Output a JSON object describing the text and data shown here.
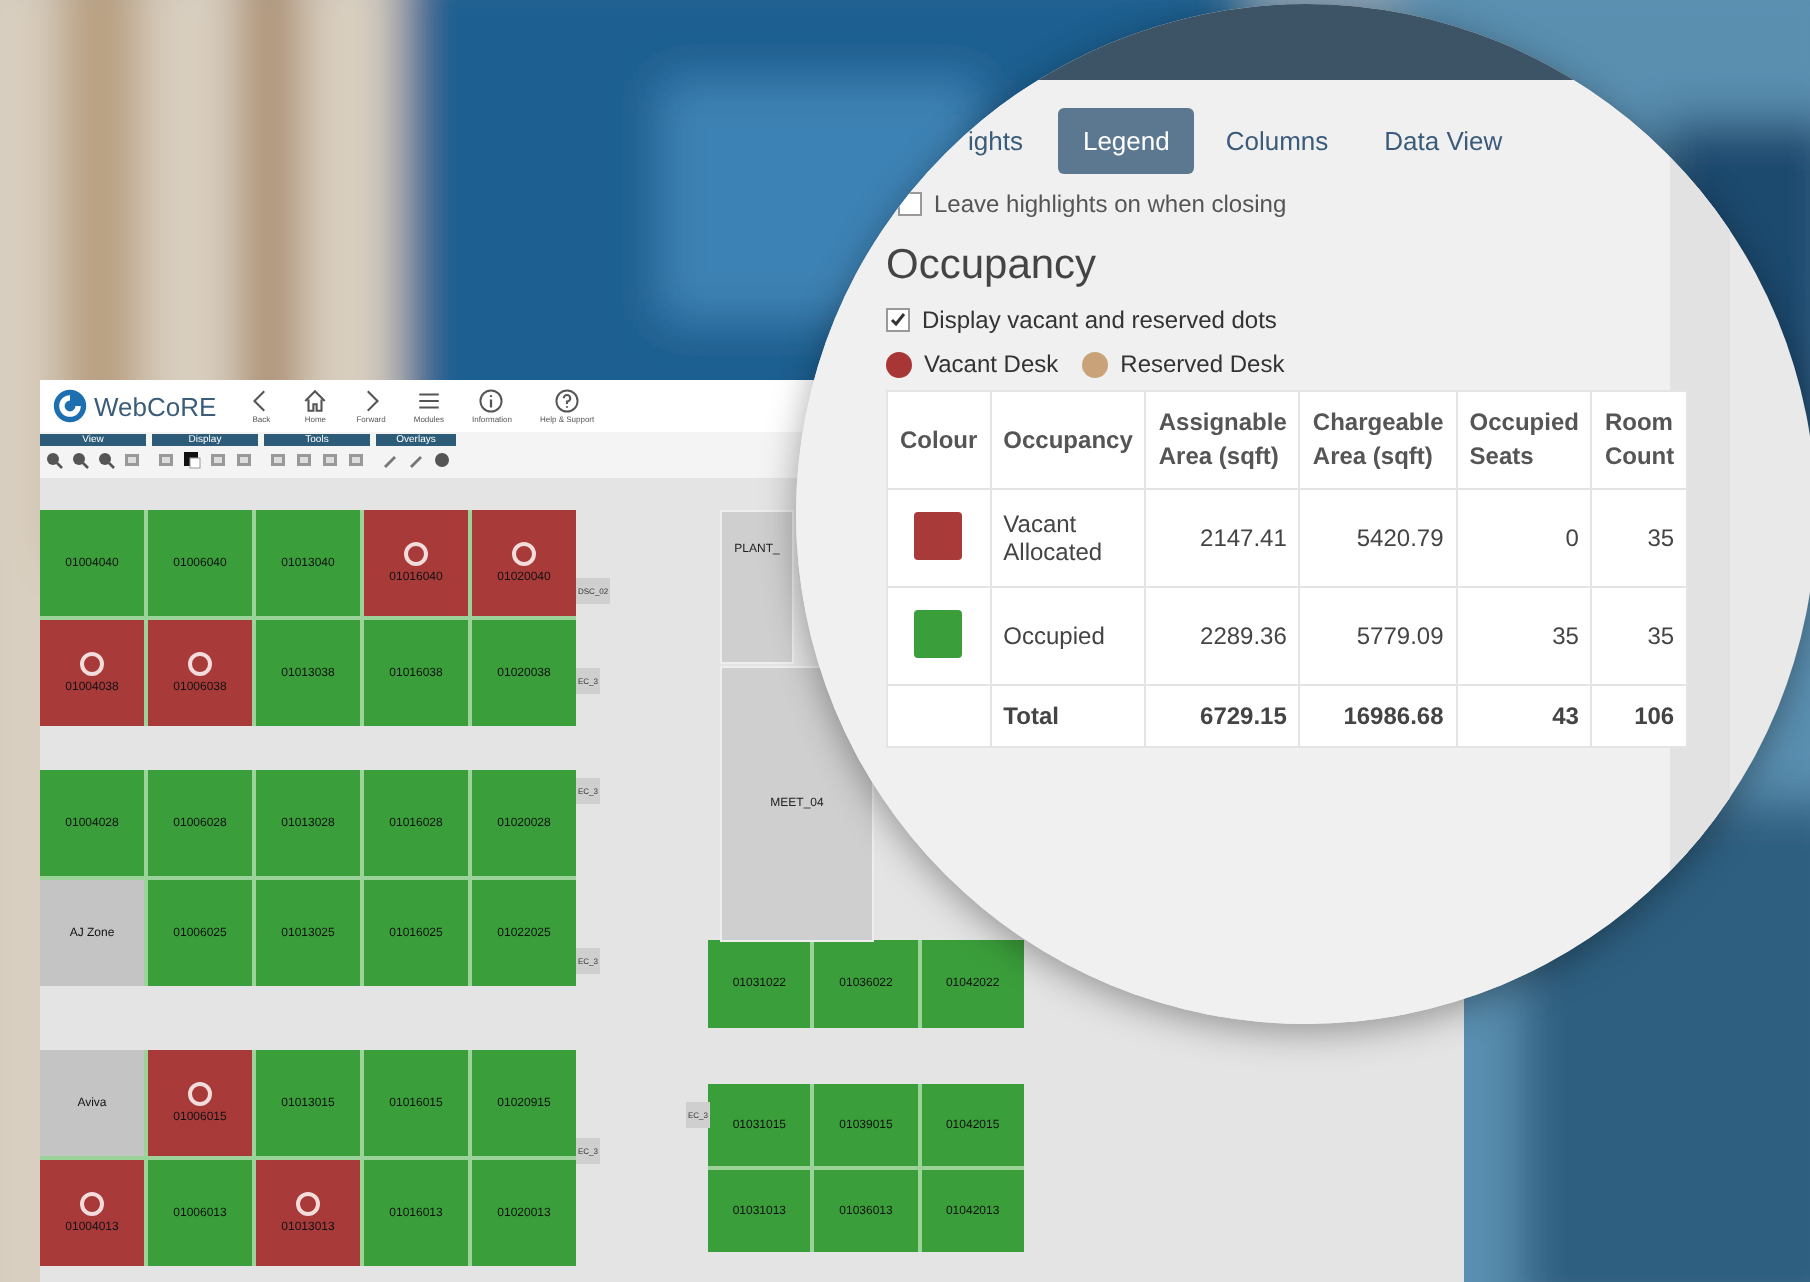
{
  "app": {
    "logo": "WebCoRE",
    "nav": [
      {
        "label": "Back"
      },
      {
        "label": "Home"
      },
      {
        "label": "Forward"
      },
      {
        "label": "Modules"
      },
      {
        "label": "Information"
      },
      {
        "label": "Help & Support"
      }
    ],
    "toolbar_groups": [
      {
        "title": "View"
      },
      {
        "title": "Display"
      },
      {
        "title": "Tools"
      },
      {
        "title": "Overlays"
      }
    ]
  },
  "floor_plan": {
    "left_blocks": [
      [
        [
          {
            "label": "01004040",
            "kind": "occupied",
            "dot": false
          },
          {
            "label": "01006040",
            "kind": "occupied",
            "dot": false
          },
          {
            "label": "01013040",
            "kind": "occupied",
            "dot": false
          },
          {
            "label": "01016040",
            "kind": "vacant",
            "dot": true
          },
          {
            "label": "01020040",
            "kind": "vacant",
            "dot": true
          }
        ],
        [
          {
            "label": "01004038",
            "kind": "vacant",
            "dot": true
          },
          {
            "label": "01006038",
            "kind": "vacant",
            "dot": true
          },
          {
            "label": "01013038",
            "kind": "occupied",
            "dot": false
          },
          {
            "label": "01016038",
            "kind": "occupied",
            "dot": false
          },
          {
            "label": "01020038",
            "kind": "occupied",
            "dot": false
          }
        ]
      ],
      [
        [
          {
            "label": "01004028",
            "kind": "occupied",
            "dot": false
          },
          {
            "label": "01006028",
            "kind": "occupied",
            "dot": false
          },
          {
            "label": "01013028",
            "kind": "occupied",
            "dot": false
          },
          {
            "label": "01016028",
            "kind": "occupied",
            "dot": false
          },
          {
            "label": "01020028",
            "kind": "occupied",
            "dot": false
          }
        ],
        [
          {
            "label": "AJ Zone",
            "kind": "zone",
            "dot": false
          },
          {
            "label": "01006025",
            "kind": "occupied",
            "dot": false
          },
          {
            "label": "01013025",
            "kind": "occupied",
            "dot": false
          },
          {
            "label": "01016025",
            "kind": "occupied",
            "dot": false
          },
          {
            "label": "01022025",
            "kind": "occupied",
            "dot": false
          }
        ]
      ],
      [
        [
          {
            "label": "Aviva",
            "kind": "zone",
            "dot": false
          },
          {
            "label": "01006015",
            "kind": "vacant",
            "dot": true
          },
          {
            "label": "01013015",
            "kind": "occupied",
            "dot": false
          },
          {
            "label": "01016015",
            "kind": "occupied",
            "dot": false
          },
          {
            "label": "01020915",
            "kind": "occupied",
            "dot": false
          }
        ],
        [
          {
            "label": "01004013",
            "kind": "vacant",
            "dot": true
          },
          {
            "label": "01006013",
            "kind": "occupied",
            "dot": false
          },
          {
            "label": "01013013",
            "kind": "vacant",
            "dot": true
          },
          {
            "label": "01016013",
            "kind": "occupied",
            "dot": false
          },
          {
            "label": "01020013",
            "kind": "occupied",
            "dot": false
          }
        ]
      ]
    ],
    "right_blocks": [
      [
        [
          {
            "label": "01031022",
            "kind": "occupied",
            "dot": false
          },
          {
            "label": "01036022",
            "kind": "occupied",
            "dot": false
          },
          {
            "label": "01042022",
            "kind": "occupied",
            "dot": false
          }
        ]
      ],
      [
        [
          {
            "label": "01031015",
            "kind": "occupied",
            "dot": false
          },
          {
            "label": "01039015",
            "kind": "occupied",
            "dot": false
          },
          {
            "label": "01042015",
            "kind": "occupied",
            "dot": false
          }
        ],
        [
          {
            "label": "01031013",
            "kind": "occupied",
            "dot": false
          },
          {
            "label": "01036013",
            "kind": "occupied",
            "dot": false
          },
          {
            "label": "01042013",
            "kind": "occupied",
            "dot": false
          }
        ]
      ]
    ],
    "rooms": [
      "PLANT_",
      "MEET_04"
    ],
    "side_tags": [
      "DSC_02",
      "EC_3",
      "EC_3",
      "EC_3",
      "EC_3",
      "EC_3"
    ]
  },
  "panel": {
    "tabs": [
      {
        "label": "ights",
        "selected": false
      },
      {
        "label": "Legend",
        "selected": true
      },
      {
        "label": "Columns",
        "selected": false
      },
      {
        "label": "Data View",
        "selected": false
      }
    ],
    "keep_highlights": {
      "label": "Leave highlights on when closing",
      "checked": false
    },
    "heading": "Occupancy",
    "show_dots": {
      "label": "Display vacant and reserved dots",
      "checked": true
    },
    "dot_legend": [
      {
        "label": "Vacant Desk",
        "color": "#a83636"
      },
      {
        "label": "Reserved Desk",
        "color": "#c9a27a"
      }
    ],
    "table": {
      "columns": [
        "Colour",
        "Occupancy",
        "Assignable Area (sqft)",
        "Chargeable Area (sqft)",
        "Occupied Seats",
        "Room Count"
      ],
      "rows": [
        {
          "color": "#a83a3a",
          "cells": [
            "",
            "Vacant Allocated",
            "2147.41",
            "5420.79",
            "0",
            "35"
          ]
        },
        {
          "color": "#3a9e3a",
          "cells": [
            "",
            "Occupied",
            "2289.36",
            "5779.09",
            "35",
            "35"
          ]
        }
      ],
      "total": {
        "cells": [
          "",
          "Total",
          "6729.15",
          "16986.68",
          "43",
          "106"
        ]
      }
    }
  }
}
